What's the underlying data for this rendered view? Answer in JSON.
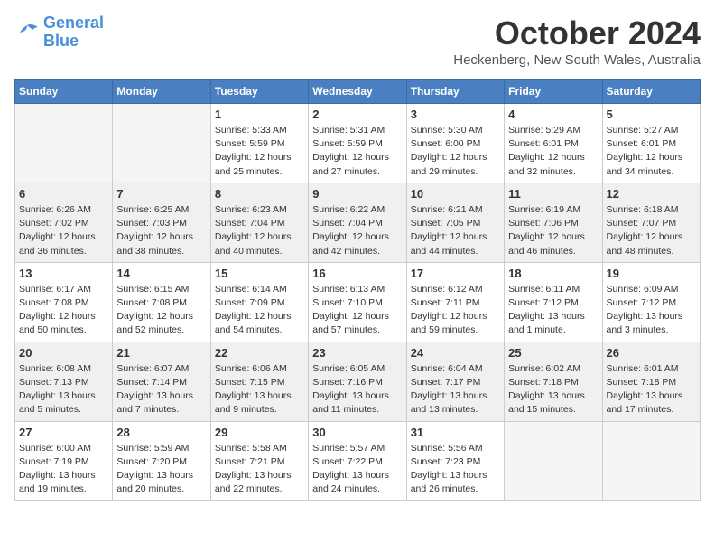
{
  "logo": {
    "line1": "General",
    "line2": "Blue"
  },
  "title": "October 2024",
  "location": "Heckenberg, New South Wales, Australia",
  "weekdays": [
    "Sunday",
    "Monday",
    "Tuesday",
    "Wednesday",
    "Thursday",
    "Friday",
    "Saturday"
  ],
  "weeks": [
    [
      {
        "day": "",
        "info": ""
      },
      {
        "day": "",
        "info": ""
      },
      {
        "day": "1",
        "info": "Sunrise: 5:33 AM\nSunset: 5:59 PM\nDaylight: 12 hours\nand 25 minutes."
      },
      {
        "day": "2",
        "info": "Sunrise: 5:31 AM\nSunset: 5:59 PM\nDaylight: 12 hours\nand 27 minutes."
      },
      {
        "day": "3",
        "info": "Sunrise: 5:30 AM\nSunset: 6:00 PM\nDaylight: 12 hours\nand 29 minutes."
      },
      {
        "day": "4",
        "info": "Sunrise: 5:29 AM\nSunset: 6:01 PM\nDaylight: 12 hours\nand 32 minutes."
      },
      {
        "day": "5",
        "info": "Sunrise: 5:27 AM\nSunset: 6:01 PM\nDaylight: 12 hours\nand 34 minutes."
      }
    ],
    [
      {
        "day": "6",
        "info": "Sunrise: 6:26 AM\nSunset: 7:02 PM\nDaylight: 12 hours\nand 36 minutes."
      },
      {
        "day": "7",
        "info": "Sunrise: 6:25 AM\nSunset: 7:03 PM\nDaylight: 12 hours\nand 38 minutes."
      },
      {
        "day": "8",
        "info": "Sunrise: 6:23 AM\nSunset: 7:04 PM\nDaylight: 12 hours\nand 40 minutes."
      },
      {
        "day": "9",
        "info": "Sunrise: 6:22 AM\nSunset: 7:04 PM\nDaylight: 12 hours\nand 42 minutes."
      },
      {
        "day": "10",
        "info": "Sunrise: 6:21 AM\nSunset: 7:05 PM\nDaylight: 12 hours\nand 44 minutes."
      },
      {
        "day": "11",
        "info": "Sunrise: 6:19 AM\nSunset: 7:06 PM\nDaylight: 12 hours\nand 46 minutes."
      },
      {
        "day": "12",
        "info": "Sunrise: 6:18 AM\nSunset: 7:07 PM\nDaylight: 12 hours\nand 48 minutes."
      }
    ],
    [
      {
        "day": "13",
        "info": "Sunrise: 6:17 AM\nSunset: 7:08 PM\nDaylight: 12 hours\nand 50 minutes."
      },
      {
        "day": "14",
        "info": "Sunrise: 6:15 AM\nSunset: 7:08 PM\nDaylight: 12 hours\nand 52 minutes."
      },
      {
        "day": "15",
        "info": "Sunrise: 6:14 AM\nSunset: 7:09 PM\nDaylight: 12 hours\nand 54 minutes."
      },
      {
        "day": "16",
        "info": "Sunrise: 6:13 AM\nSunset: 7:10 PM\nDaylight: 12 hours\nand 57 minutes."
      },
      {
        "day": "17",
        "info": "Sunrise: 6:12 AM\nSunset: 7:11 PM\nDaylight: 12 hours\nand 59 minutes."
      },
      {
        "day": "18",
        "info": "Sunrise: 6:11 AM\nSunset: 7:12 PM\nDaylight: 13 hours\nand 1 minute."
      },
      {
        "day": "19",
        "info": "Sunrise: 6:09 AM\nSunset: 7:12 PM\nDaylight: 13 hours\nand 3 minutes."
      }
    ],
    [
      {
        "day": "20",
        "info": "Sunrise: 6:08 AM\nSunset: 7:13 PM\nDaylight: 13 hours\nand 5 minutes."
      },
      {
        "day": "21",
        "info": "Sunrise: 6:07 AM\nSunset: 7:14 PM\nDaylight: 13 hours\nand 7 minutes."
      },
      {
        "day": "22",
        "info": "Sunrise: 6:06 AM\nSunset: 7:15 PM\nDaylight: 13 hours\nand 9 minutes."
      },
      {
        "day": "23",
        "info": "Sunrise: 6:05 AM\nSunset: 7:16 PM\nDaylight: 13 hours\nand 11 minutes."
      },
      {
        "day": "24",
        "info": "Sunrise: 6:04 AM\nSunset: 7:17 PM\nDaylight: 13 hours\nand 13 minutes."
      },
      {
        "day": "25",
        "info": "Sunrise: 6:02 AM\nSunset: 7:18 PM\nDaylight: 13 hours\nand 15 minutes."
      },
      {
        "day": "26",
        "info": "Sunrise: 6:01 AM\nSunset: 7:18 PM\nDaylight: 13 hours\nand 17 minutes."
      }
    ],
    [
      {
        "day": "27",
        "info": "Sunrise: 6:00 AM\nSunset: 7:19 PM\nDaylight: 13 hours\nand 19 minutes."
      },
      {
        "day": "28",
        "info": "Sunrise: 5:59 AM\nSunset: 7:20 PM\nDaylight: 13 hours\nand 20 minutes."
      },
      {
        "day": "29",
        "info": "Sunrise: 5:58 AM\nSunset: 7:21 PM\nDaylight: 13 hours\nand 22 minutes."
      },
      {
        "day": "30",
        "info": "Sunrise: 5:57 AM\nSunset: 7:22 PM\nDaylight: 13 hours\nand 24 minutes."
      },
      {
        "day": "31",
        "info": "Sunrise: 5:56 AM\nSunset: 7:23 PM\nDaylight: 13 hours\nand 26 minutes."
      },
      {
        "day": "",
        "info": ""
      },
      {
        "day": "",
        "info": ""
      }
    ]
  ]
}
